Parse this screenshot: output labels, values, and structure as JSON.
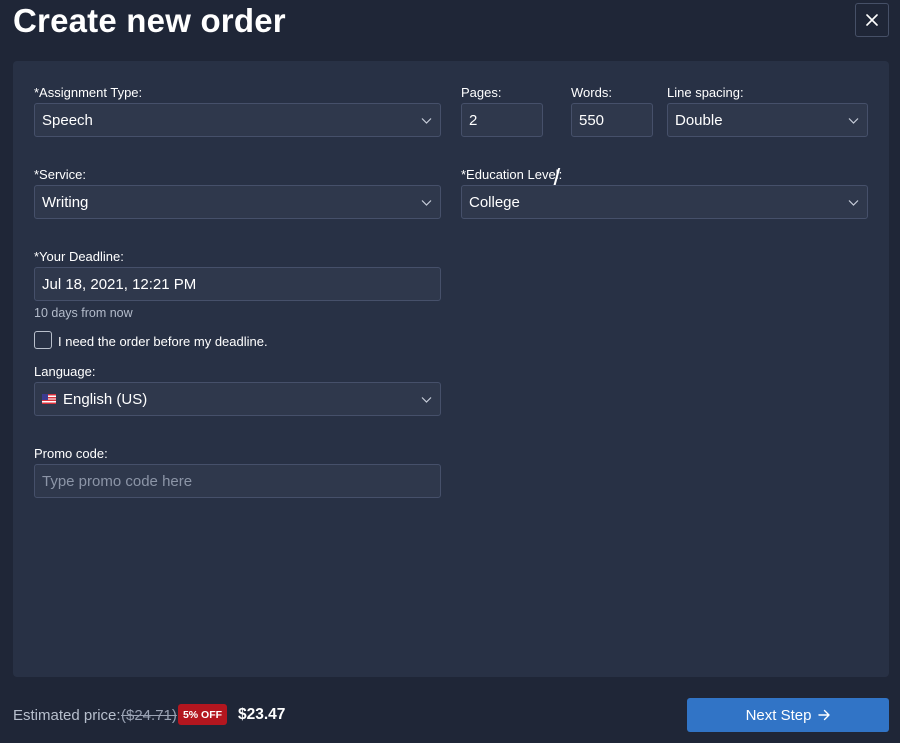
{
  "header": {
    "title": "Create new order"
  },
  "form": {
    "assignment_type": {
      "label": "*Assignment Type:",
      "value": "Speech"
    },
    "pages": {
      "label": "Pages:",
      "value": "2"
    },
    "separator": "/",
    "words": {
      "label": "Words:",
      "value": "550"
    },
    "line_spacing": {
      "label": "Line spacing:",
      "value": "Double"
    },
    "service": {
      "label": "*Service:",
      "value": "Writing"
    },
    "education_level": {
      "label": "*Education Level:",
      "value": "College"
    },
    "deadline": {
      "label": "*Your Deadline:",
      "value": "Jul 18, 2021, 12:21 PM",
      "hint": "10 days from now"
    },
    "before_deadline": {
      "label": "I need the order before my deadline.",
      "checked": false
    },
    "language": {
      "label": "Language:",
      "value": "English (US)",
      "flag_icon": "us-flag-icon"
    },
    "promo": {
      "label": "Promo code:",
      "placeholder": "Type promo code here",
      "value": ""
    }
  },
  "footer": {
    "estimated_label": "Estimated price:",
    "old_price": "($24.71)",
    "discount": "5% OFF",
    "price": "$23.47",
    "next_label": "Next Step"
  },
  "colors": {
    "background": "#1f2637",
    "panel": "#283145",
    "input": "#2f384c",
    "accent": "#3174c6",
    "discount": "#b3161f"
  }
}
